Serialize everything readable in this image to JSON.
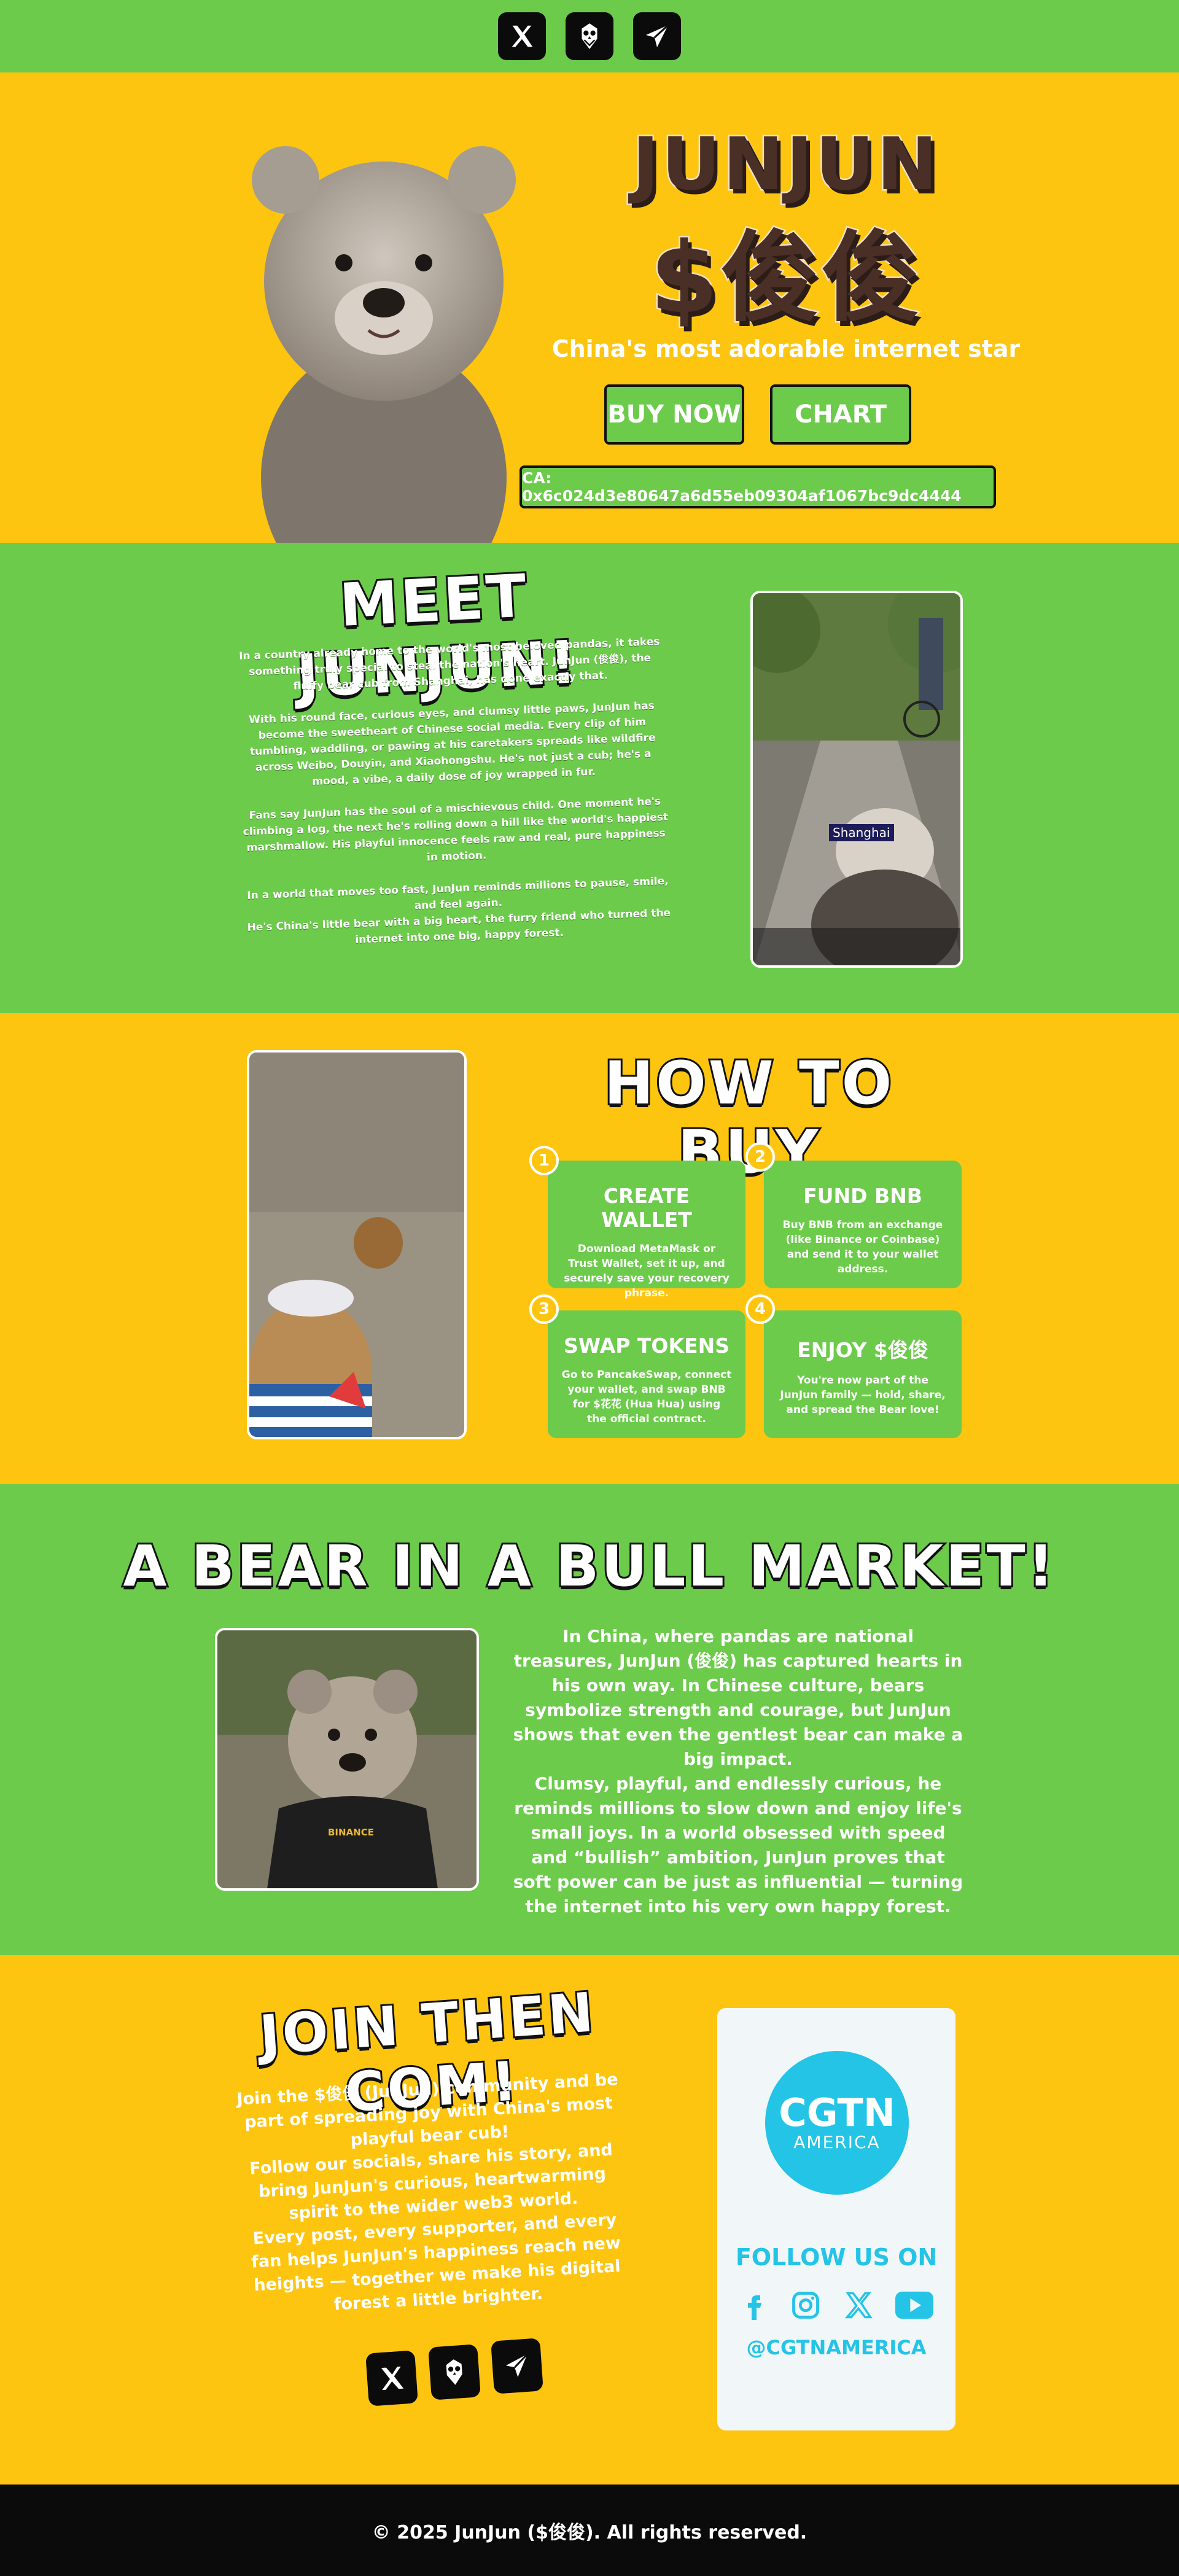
{
  "topbar": {
    "icons": [
      "x-icon",
      "owl-icon",
      "telegram-icon"
    ]
  },
  "hero": {
    "title_line1": "JUNJUN",
    "title_line2": "$俊俊",
    "tagline": "China's most adorable internet star",
    "buy_label": "BUY NOW",
    "chart_label": "CHART",
    "contract": "CA: 0x6c024d3e80647a6d55eb09304af1067bc9dc4444"
  },
  "meet": {
    "title": "MEET JUNJUN!",
    "paragraphs": [
      "In a country already home to the world's most beloved pandas, it takes something truly special to steal the nation's heart. JunJun (俊俊), the fluffy bear cub from Shanghai, has done exactly that.",
      "With his round face, curious eyes, and clumsy little paws, JunJun has become the sweetheart of Chinese social media. Every clip of him tumbling, waddling, or pawing at his caretakers spreads like wildfire across Weibo, Douyin, and Xiaohongshu. He's not just a cub; he's a mood, a vibe, a daily dose of joy wrapped in fur.",
      "Fans say JunJun has the soul of a mischievous child. One moment he's climbing a log, the next he's rolling down a hill like the world's happiest marshmallow. His playful innocence feels raw and real, pure happiness in motion.",
      "In a world that moves too fast, JunJun reminds millions to pause, smile, and feel again.",
      "He's China's little bear with a big heart, the furry friend who turned the internet into one big, happy forest."
    ],
    "video_caption": "Shanghai"
  },
  "howto": {
    "title": "HOW TO BUY",
    "steps": [
      {
        "num": "1",
        "title": "CREATE WALLET",
        "text": "Download MetaMask or Trust Wallet, set it up, and securely save your recovery phrase."
      },
      {
        "num": "2",
        "title": "FUND BNB",
        "text": "Buy BNB from an exchange (like Binance or Coinbase) and send it to your wallet address."
      },
      {
        "num": "3",
        "title": "SWAP TOKENS",
        "text": "Go to PancakeSwap, connect your wallet, and swap BNB for $花花 (Hua Hua) using the official contract."
      },
      {
        "num": "4",
        "title": "ENJOY $俊俊",
        "text": "You're now part of the JunJun family — hold, share, and spread the Bear love!"
      }
    ]
  },
  "bull": {
    "title": "A BEAR IN A BULL MARKET!",
    "p1": "In China, where pandas are national treasures, JunJun (俊俊) has captured hearts in his own way. In Chinese culture, bears symbolize strength and courage, but JunJun shows that even the gentlest bear can make a big impact.",
    "p2": "Clumsy, playful, and endlessly curious, he reminds millions to slow down and enjoy life's small joys. In a world obsessed with speed and “bullish” ambition, JunJun proves that soft power can be just as influential — turning the internet into his very own happy forest.",
    "shirt_logo": "BINANCE"
  },
  "join": {
    "title": "JOIN THEN COM!",
    "p1": "Join the $俊俊 (JunJun) community and be part of spreading joy with China's most playful bear cub!",
    "p2": "Follow our socials, share his story, and bring JunJun's curious, heartwarming spirit to the wider web3 world.",
    "p3": "Every post, every supporter, and every fan helps JunJun's happiness reach new heights — together we make his digital forest a little brighter."
  },
  "cgtn": {
    "logo_main": "CGTN",
    "logo_sub": "AMERICA",
    "follow": "FOLLOW US ON",
    "handle": "@CGTNAMERICA",
    "icons": [
      "facebook-icon",
      "instagram-icon",
      "x-icon",
      "youtube-icon"
    ]
  },
  "footer": {
    "text": "© 2025 JunJun ($俊俊). All rights reserved."
  },
  "colors": {
    "green": "#6ccb4b",
    "yellow": "#fdc50f",
    "black": "#0b0b0b",
    "cgtn_blue": "#23c4e6"
  }
}
